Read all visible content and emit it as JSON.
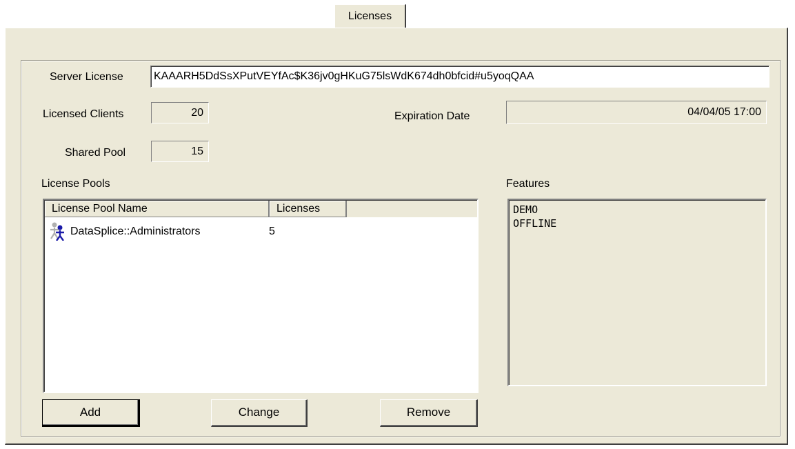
{
  "tabs": [
    {
      "label": "Licenses"
    }
  ],
  "server_license": {
    "label": "Server License",
    "value": "KAAARH5DdSsXPutVEYfAc$K36jv0gHKuG75lsWdK674dh0bfcid#u5yoqQAA"
  },
  "licensed_clients": {
    "label": "Licensed Clients",
    "value": "20"
  },
  "shared_pool": {
    "label": "Shared Pool",
    "value": "15"
  },
  "expiration_date": {
    "label": "Expiration Date",
    "value": "04/04/05 17:00"
  },
  "license_pools": {
    "label": "License Pools",
    "columns": [
      "License Pool Name",
      "Licenses"
    ],
    "rows": [
      {
        "icon": "user-group-icon",
        "name": "DataSplice::Administrators",
        "licenses": "5"
      }
    ]
  },
  "features": {
    "label": "Features",
    "items": [
      "DEMO",
      "OFFLINE"
    ]
  },
  "buttons": {
    "add": "Add",
    "change": "Change",
    "remove": "Remove"
  }
}
